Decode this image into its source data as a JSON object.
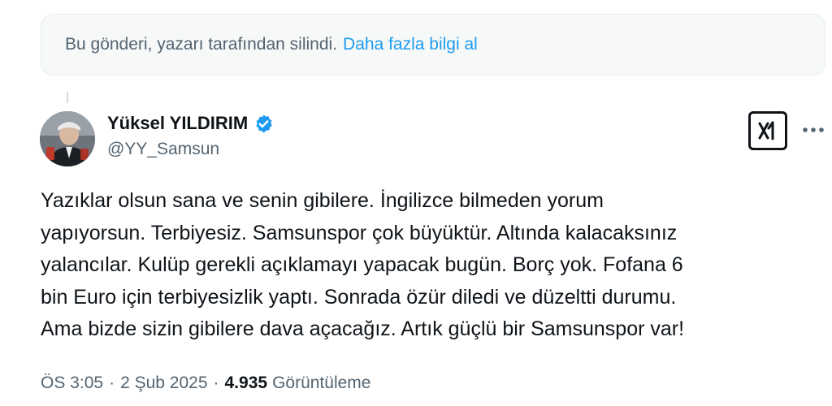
{
  "deleted_notice": {
    "text": "Bu gönderi, yazarı tarafından silindi.",
    "link": "Daha fazla bilgi al"
  },
  "colors": {
    "link": "#1d9bf0",
    "muted": "#536471",
    "text": "#0f1419",
    "verified": "#1d9bf0"
  },
  "author": {
    "name": "Yüksel YILDIRIM",
    "handle": "@YY_Samsun",
    "verified": true,
    "avatar_icon": "avatar-photo"
  },
  "actions": {
    "grok_icon": "grok-icon",
    "more_icon": "more-dots-icon"
  },
  "tweet": {
    "lines": [
      "Yazıklar olsun sana ve senin gibilere. İngilizce bilmeden yorum",
      "yapıyorsun. Terbiyesiz. Samsunspor çok büyüktür. Altında kalacaksınız",
      "yalancılar. Kulüp gerekli açıklamayı yapacak bugün. Borç yok. Fofana 6",
      "bin Euro için terbiyesizlik yaptı. Sonrada özür diledi ve düzeltti durumu.",
      "Ama bizde sizin gibilere dava açacağız. Artık güçlü bir Samsunspor var!"
    ]
  },
  "meta": {
    "time": "ÖS 3:05",
    "date": "2 Şub 2025",
    "views_count": "4.935",
    "views_label": "Görüntüleme",
    "separator": "·"
  }
}
